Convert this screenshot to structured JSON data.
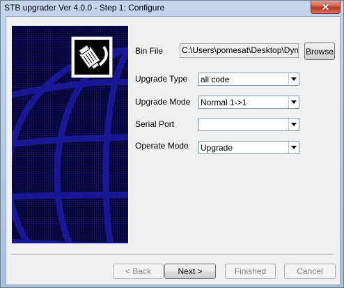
{
  "window": {
    "title": "STB upgrader Ver 4.0.0 - Step 1: Configure",
    "close_glyph": "✕"
  },
  "form": {
    "bin_file": {
      "label": "Bin File",
      "value": "C:\\Users\\pomesat\\Desktop\\Dyna-",
      "browse_label": "Browse"
    },
    "upgrade_type": {
      "label": "Upgrade Type",
      "value": "all code"
    },
    "upgrade_mode": {
      "label": "Upgrade Mode",
      "value": "Normal 1->1"
    },
    "serial_port": {
      "label": "Serial Port",
      "value": ""
    },
    "operate_mode": {
      "label": "Operate Mode",
      "value": "Upgrade"
    }
  },
  "footer": {
    "back_label": "< Back",
    "next_label": "Next >",
    "finished_label": "Finished",
    "cancel_label": "Cancel"
  },
  "icons": [
    "close-icon",
    "network-cable-icon",
    "chevron-down-icon"
  ],
  "colors": {
    "side_panel": "#000018",
    "globe_lines": "#1a1a9a"
  }
}
